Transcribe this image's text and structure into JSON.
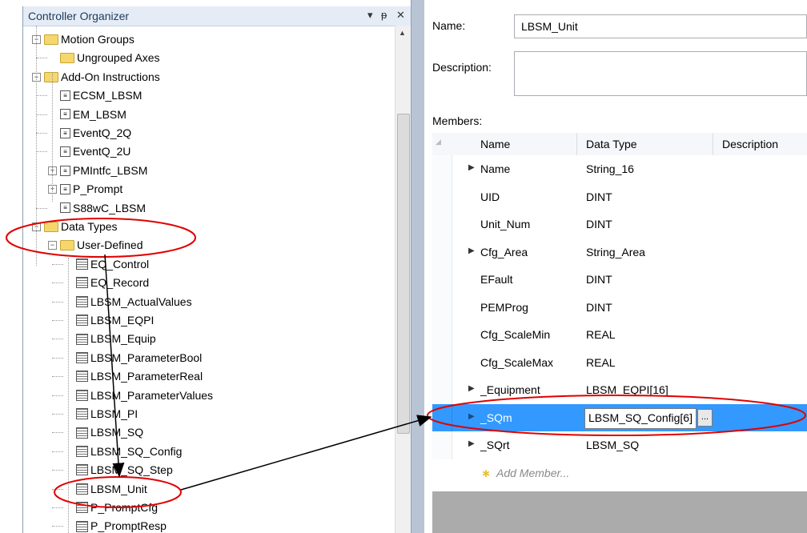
{
  "left": {
    "title": "Controller Organizer",
    "header_buttons": [
      "▾",
      "ᵽ",
      "✕"
    ],
    "tree": [
      {
        "label": "Motion Groups",
        "icon": "folder-icon"
      },
      {
        "label": "Ungrouped Axes",
        "icon": "folder-icon"
      },
      {
        "label": "Add-On Instructions",
        "icon": "folder-icon"
      },
      {
        "label": "ECSM_LBSM",
        "icon": "aoi-icon"
      },
      {
        "label": "EM_LBSM",
        "icon": "aoi-icon"
      },
      {
        "label": "EventQ_2Q",
        "icon": "aoi-icon"
      },
      {
        "label": "EventQ_2U",
        "icon": "aoi-icon"
      },
      {
        "label": "PMIntfc_LBSM",
        "icon": "aoi-icon"
      },
      {
        "label": "P_Prompt",
        "icon": "aoi-icon"
      },
      {
        "label": "S88wC_LBSM",
        "icon": "aoi-icon"
      },
      {
        "label": "Data Types",
        "icon": "folder-icon"
      },
      {
        "label": "User-Defined",
        "icon": "folder-icon"
      },
      {
        "label": "EQ_Control",
        "icon": "udt-icon"
      },
      {
        "label": "EQ_Record",
        "icon": "udt-icon"
      },
      {
        "label": "LBSM_ActualValues",
        "icon": "udt-icon"
      },
      {
        "label": "LBSM_EQPI",
        "icon": "udt-icon"
      },
      {
        "label": "LBSM_Equip",
        "icon": "udt-icon"
      },
      {
        "label": "LBSM_ParameterBool",
        "icon": "udt-icon"
      },
      {
        "label": "LBSM_ParameterReal",
        "icon": "udt-icon"
      },
      {
        "label": "LBSM_ParameterValues",
        "icon": "udt-icon"
      },
      {
        "label": "LBSM_PI",
        "icon": "udt-icon"
      },
      {
        "label": "LBSM_SQ",
        "icon": "udt-icon"
      },
      {
        "label": "LBSM_SQ_Config",
        "icon": "udt-icon"
      },
      {
        "label": "LBSM_SQ_Step",
        "icon": "udt-icon"
      },
      {
        "label": "LBSM_Unit",
        "icon": "udt-icon"
      },
      {
        "label": "P_PromptCfg",
        "icon": "udt-icon"
      },
      {
        "label": "P_PromptResp",
        "icon": "udt-icon"
      }
    ]
  },
  "right": {
    "name_label": "Name:",
    "name_value": "LBSM_Unit",
    "description_label": "Description:",
    "description_value": "",
    "members_label": "Members:",
    "columns": [
      "Name",
      "Data Type",
      "Description"
    ],
    "members": [
      {
        "name": "Name",
        "type": "String_16",
        "expandable": true
      },
      {
        "name": "UID",
        "type": "DINT",
        "expandable": false
      },
      {
        "name": "Unit_Num",
        "type": "DINT",
        "expandable": false
      },
      {
        "name": "Cfg_Area",
        "type": "String_Area",
        "expandable": true
      },
      {
        "name": "EFault",
        "type": "DINT",
        "expandable": false
      },
      {
        "name": "PEMProg",
        "type": "DINT",
        "expandable": false
      },
      {
        "name": "Cfg_ScaleMin",
        "type": "REAL",
        "expandable": false
      },
      {
        "name": "Cfg_ScaleMax",
        "type": "REAL",
        "expandable": false
      },
      {
        "name": "_Equipment",
        "type": "LBSM_EQPI[16]",
        "expandable": true
      },
      {
        "name": "_SQm",
        "type": "LBSM_SQ_Config[6]",
        "expandable": true,
        "selected": true
      },
      {
        "name": "_SQrt",
        "type": "LBSM_SQ",
        "expandable": true
      }
    ],
    "add_member": "Add Member...",
    "ellipsis": "..."
  },
  "colors": {
    "selection": "#3399ff",
    "annotation": "#e00000",
    "splitter": "#b8c4d4"
  }
}
